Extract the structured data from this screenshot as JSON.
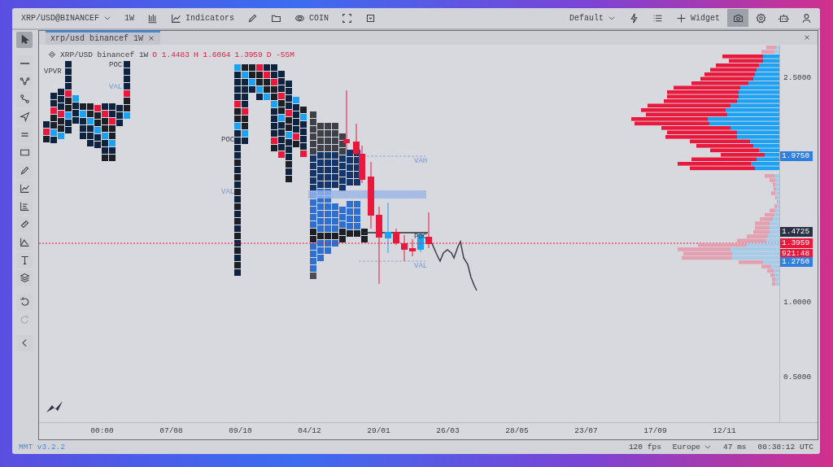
{
  "toolbar": {
    "symbol": "XRP/USD@BINANCEF",
    "timeframe": "1W",
    "indicators": "Indicators",
    "exchange": "COIN",
    "layout": "Default",
    "widget": "Widget"
  },
  "top_icons": [
    {
      "kind": "bolt",
      "selected": false
    },
    {
      "kind": "list",
      "selected": false
    }
  ],
  "top_right_icons": [
    {
      "kind": "camera",
      "selected": true
    },
    {
      "kind": "settings",
      "selected": false
    },
    {
      "kind": "robot",
      "selected": false
    },
    {
      "kind": "user",
      "selected": false
    }
  ],
  "drawing_tools": [
    {
      "kind": "cursor",
      "selected": true
    },
    {
      "kind": "line",
      "selected": false
    },
    {
      "kind": "nodes",
      "selected": false
    },
    {
      "kind": "path",
      "selected": false
    },
    {
      "kind": "send",
      "selected": false
    },
    {
      "kind": "parallel",
      "selected": false
    },
    {
      "kind": "rect",
      "selected": false
    },
    {
      "kind": "brush",
      "selected": false
    },
    {
      "kind": "linechart",
      "selected": false
    },
    {
      "kind": "bars",
      "selected": false
    },
    {
      "kind": "ruler",
      "selected": false
    },
    {
      "kind": "area",
      "selected": false
    },
    {
      "kind": "text",
      "selected": false
    },
    {
      "kind": "layers",
      "selected": false
    }
  ],
  "history": [
    {
      "kind": "undo",
      "disabled": false
    },
    {
      "kind": "redo",
      "disabled": true
    }
  ],
  "tab": {
    "label": "xrp/usd binancef 1W",
    "selected": true
  },
  "legend": {
    "symbol": "XRP/USD binancef 1W",
    "values": [
      "O 1.4483",
      "H 1.6064",
      "1.3959",
      "D -55M"
    ]
  },
  "overlay_labels": [
    {
      "text": "VPVR",
      "kind": "name"
    },
    {
      "text": "POC",
      "kind": "poc"
    },
    {
      "text": "VAL",
      "kind": "value_area"
    },
    {
      "text": "POC",
      "kind": "poc"
    },
    {
      "text": "VAL",
      "kind": "value_area"
    },
    {
      "text": "VAH",
      "kind": "value_area"
    },
    {
      "text": "POC",
      "kind": "poc"
    },
    {
      "text": "VAL",
      "kind": "value_area"
    }
  ],
  "price_axis": [
    "2.5000",
    "1.0000",
    "0.5000"
  ],
  "price_tags": [
    {
      "text": "1.9750",
      "color": "#2f7fe0"
    },
    {
      "text": "1.4725",
      "color": "#2a3142"
    },
    {
      "text": "1.3959",
      "color": "#e8193c"
    },
    {
      "text": "921:48",
      "color": "#e8193c"
    },
    {
      "text": "1.2750",
      "color": "#2f7fe0"
    }
  ],
  "time_axis": [
    "00:00",
    "07/08",
    "09/10",
    "04/12",
    "29/01",
    "26/03",
    "28/05",
    "23/07",
    "17/09",
    "12/11"
  ],
  "status_bar": {
    "version": "MMT v3.2.2",
    "fps": "120 fps",
    "region": "Europe",
    "latency": "47 ms",
    "clock": "08:38:12 UTC"
  }
}
